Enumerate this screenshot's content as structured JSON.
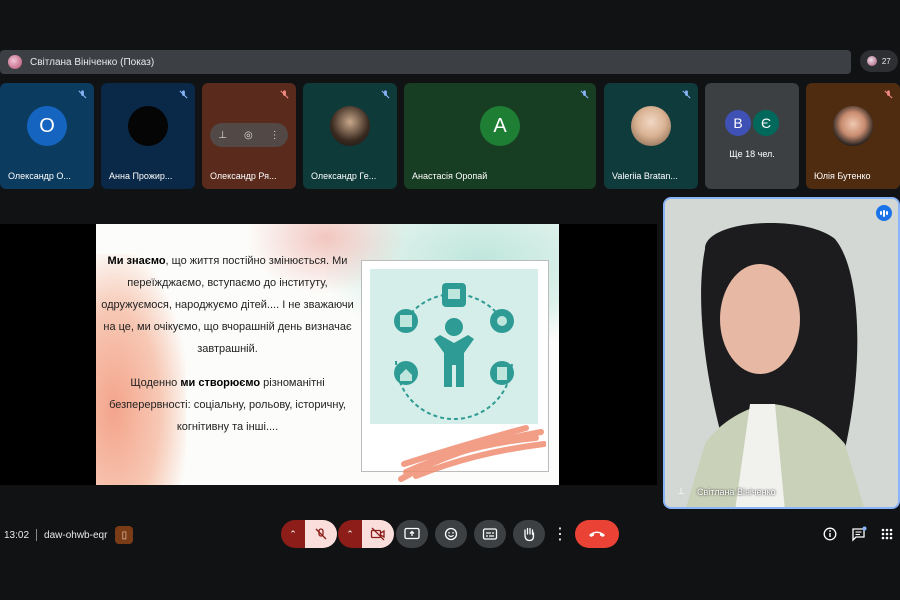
{
  "presenter": {
    "label": "Світлана Вініченко (Показ)",
    "participant_count": "27"
  },
  "tiles": [
    {
      "name": "Олександр О...",
      "initial": "О",
      "bg": "#0b3b5e",
      "avatar_color": "#1565c0"
    },
    {
      "name": "Анна Прожир...",
      "bg": "#0a2948"
    },
    {
      "name": "Олександр Ря...",
      "bg": "#5a2a1c"
    },
    {
      "name": "Олександр Ге...",
      "bg": "#0e3a3a"
    },
    {
      "name": "Анастасія Оропай",
      "initial": "A",
      "bg": "#173d23",
      "avatar_color": "#1e7e34"
    },
    {
      "name": "Valeriia Bratan...",
      "bg": "#0f3b3d"
    },
    {
      "name": "Ще 18 чел.",
      "initials": [
        "В",
        "Є"
      ],
      "bg": "#3c4043"
    },
    {
      "name": "Юлія Бутенко",
      "bg": "#4f2c10"
    }
  ],
  "slide": {
    "para1_bold": "Ми знаємо",
    "para1_rest": ", що життя постійно змінюється. Ми переїжджаємо, вступаємо до інституту, одружуємося, народжуємо дітей.... І не зважаючи на це, ми очікуємо, що вчорашній день визначає завтрашній.",
    "para2_start": "Щоденно ",
    "para2_bold": "ми створюємо",
    "para2_rest": " різноманітні безперервності: соціальну, рольову, історичну, когнітивну та інші...."
  },
  "self_view": {
    "name": "Світлана Вініченко"
  },
  "meeting": {
    "time": "13:02",
    "code": "daw-ohwb-eqr"
  },
  "controls": {
    "icons": [
      "chevron-up-icon",
      "mic-off-icon",
      "camera-off-icon",
      "present-icon",
      "emoji-icon",
      "captions-icon",
      "raise-hand-icon",
      "more-icon",
      "end-call-icon",
      "info-icon",
      "chat-icon",
      "activities-icon"
    ]
  },
  "colors": {
    "accent": "#8ab4f8",
    "danger": "#ea4335",
    "muted_bg": "#8c1d18",
    "muted_fg": "#f9dedc"
  }
}
